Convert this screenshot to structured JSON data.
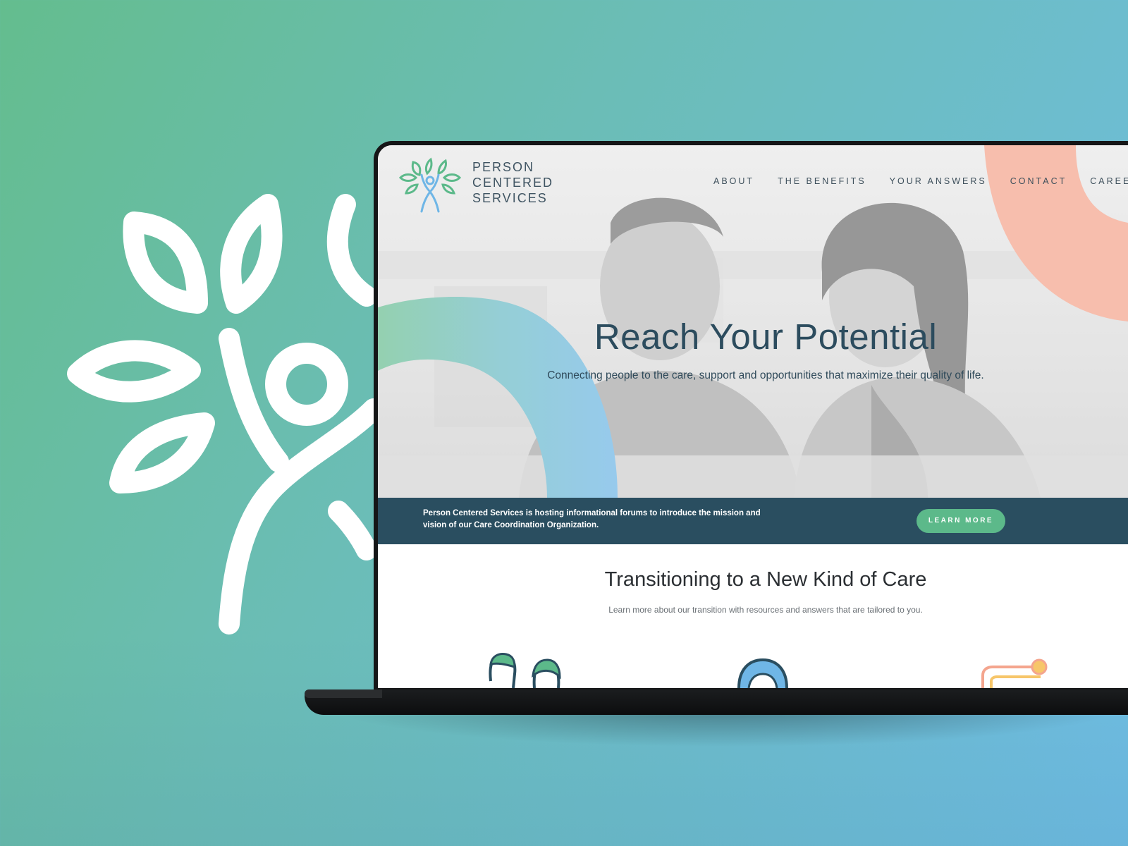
{
  "brand": {
    "line1": "PERSON",
    "line2": "CENTERED",
    "line3": "SERVICES"
  },
  "nav": {
    "items": [
      "ABOUT",
      "THE BENEFITS",
      "YOUR ANSWERS",
      "CONTACT",
      "CAREE"
    ]
  },
  "hero": {
    "title": "Reach Your Potential",
    "subtitle": "Connecting people to the care, support and opportunities that maximize their quality of life."
  },
  "banner": {
    "text": "Person Centered Services is hosting informational forums to introduce the mission and vision of our Care Coordination Organization.",
    "button_label": "LEARN MORE"
  },
  "section": {
    "title": "Transitioning to a New Kind of Care",
    "subtitle": "Learn more about our transition with resources and answers that are tailored to you."
  },
  "icons": {
    "background_logo": "tree-person-icon",
    "header_logo": "tree-person-icon",
    "card_icons": [
      "two-people-icon",
      "person-icon",
      "chat-bubbles-icon"
    ]
  },
  "colors": {
    "green": "#5cb98a",
    "blue": "#6fb6e6",
    "navy": "#2a4e60",
    "coral": "#f4a58e"
  }
}
